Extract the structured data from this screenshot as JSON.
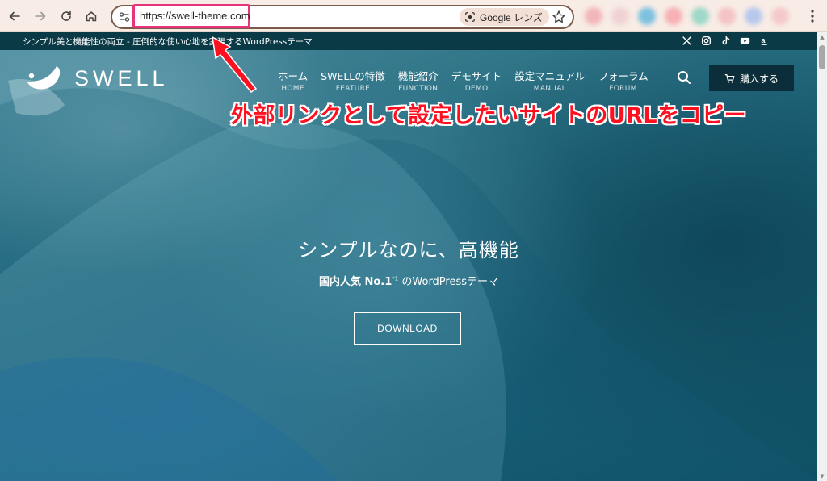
{
  "browser": {
    "url": "https://swell-theme.com",
    "lens_label": "Google レンズ",
    "ext_colors": [
      "#f3b6b8",
      "#f0d2d4",
      "#7ec1df",
      "#f7b0b4",
      "#9ed8c7",
      "#f3c3c5",
      "#b8c8ec",
      "#f4c9cb"
    ]
  },
  "topbar": {
    "tagline": "シンプル美と機能性の両立 - 圧倒的な使い心地を実現するWordPressテーマ",
    "social": [
      "x-icon",
      "instagram-icon",
      "tiktok-icon",
      "youtube-icon",
      "amazon-icon"
    ]
  },
  "header": {
    "logo_text": "SWELL",
    "nav": [
      {
        "ja": "ホーム",
        "en": "HOME"
      },
      {
        "ja": "SWELLの特徴",
        "en": "FEATURE"
      },
      {
        "ja": "機能紹介",
        "en": "FUNCTION"
      },
      {
        "ja": "デモサイト",
        "en": "DEMO"
      },
      {
        "ja": "設定マニュアル",
        "en": "MANUAL"
      },
      {
        "ja": "フォーラム",
        "en": "FORUM"
      }
    ],
    "buy_label": "購入する"
  },
  "annotation": {
    "text": "外部リンクとして設定したいサイトのURLをコピー",
    "color": "#ff1020"
  },
  "hero": {
    "title": "シンプルなのに、高機能",
    "sub_prefix": "– ",
    "sub_bold": "国内人気 No.1",
    "sub_sup": "*1",
    "sub_suffix": " のWordPressテーマ –",
    "download_label": "DOWNLOAD"
  }
}
